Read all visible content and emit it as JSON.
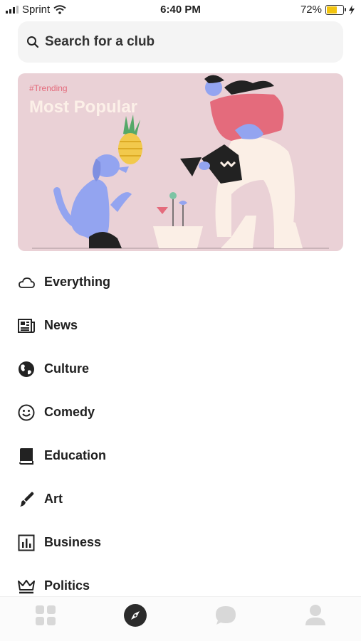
{
  "status_bar": {
    "carrier": "Sprint",
    "time": "6:40 PM",
    "battery": "72%",
    "battery_level": 0.72
  },
  "search": {
    "placeholder": "Search for a club"
  },
  "hero": {
    "tag": "#Trending",
    "title": "Most Popular"
  },
  "categories": [
    {
      "label": "Everything",
      "icon": "cloud-icon"
    },
    {
      "label": "News",
      "icon": "newspaper-icon"
    },
    {
      "label": "Culture",
      "icon": "globe-icon"
    },
    {
      "label": "Comedy",
      "icon": "smiley-icon"
    },
    {
      "label": "Education",
      "icon": "book-icon"
    },
    {
      "label": "Art",
      "icon": "brush-icon"
    },
    {
      "label": "Business",
      "icon": "bar-chart-icon"
    },
    {
      "label": "Politics",
      "icon": "crown-icon"
    }
  ],
  "tabbar": {
    "tabs": [
      {
        "icon": "grid-icon",
        "active": false
      },
      {
        "icon": "compass-icon",
        "active": true
      },
      {
        "icon": "chat-bubble-icon",
        "active": false
      },
      {
        "icon": "profile-icon",
        "active": false
      }
    ]
  },
  "colors": {
    "accent": "#2b2b2b",
    "hero_bg": "#ead1d6",
    "tag": "#e46b7c",
    "inactive_tab": "#d8d8d8"
  }
}
